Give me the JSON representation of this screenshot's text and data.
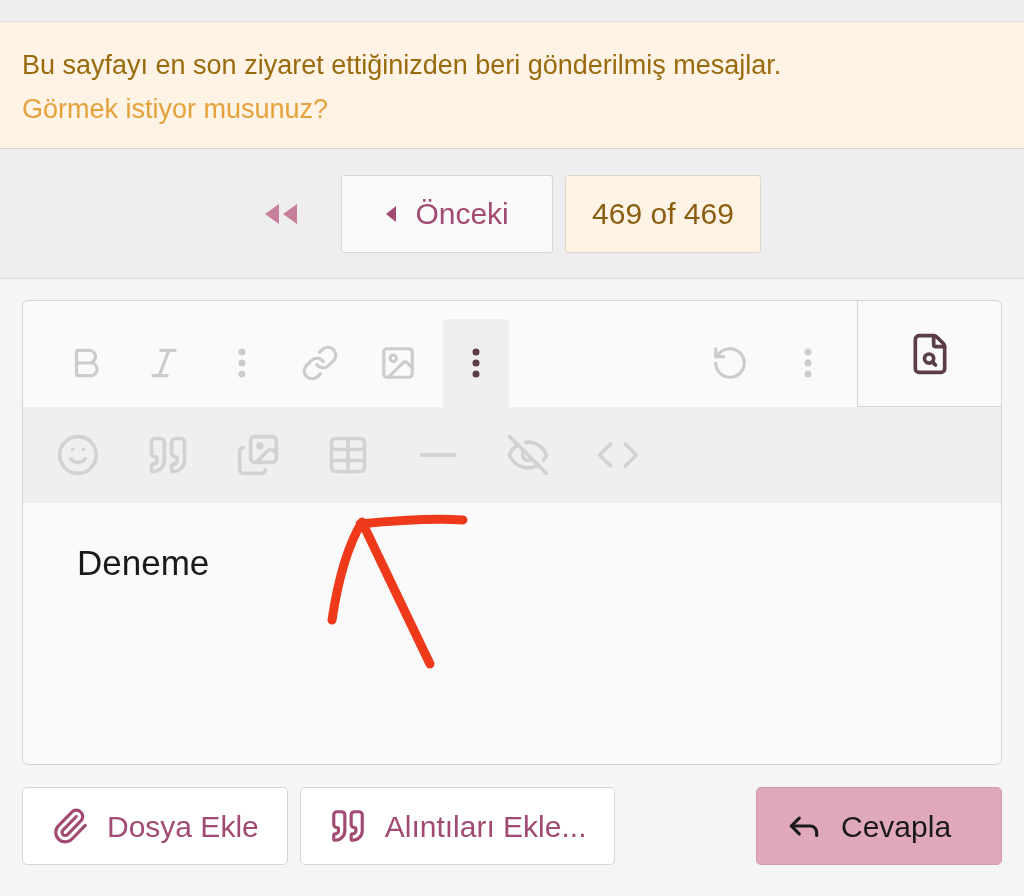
{
  "notice": {
    "message": "Bu sayfayı en son ziyaret ettiğinizden beri gönderilmiş mesajlar.",
    "link": "Görmek istiyor musunuz?"
  },
  "pagination": {
    "previous": "Önceki",
    "page": "469 of 469"
  },
  "editor": {
    "toolbar_row_1": [
      {
        "kind": "bold",
        "expanded": false
      },
      {
        "kind": "italic",
        "expanded": false
      },
      {
        "kind": "more",
        "expanded": false
      },
      {
        "kind": "link",
        "expanded": false
      },
      {
        "kind": "image",
        "expanded": false
      },
      {
        "kind": "more",
        "expanded": true
      },
      {
        "kind": "spacer"
      },
      {
        "kind": "undo",
        "expanded": false
      },
      {
        "kind": "more",
        "expanded": false
      }
    ],
    "toolbar_row_2": [
      {
        "kind": "smilie"
      },
      {
        "kind": "quote"
      },
      {
        "kind": "media"
      },
      {
        "kind": "table"
      },
      {
        "kind": "rule"
      },
      {
        "kind": "spoiler"
      },
      {
        "kind": "code"
      }
    ],
    "value": "Deneme"
  },
  "actions": [
    {
      "kind": "attach",
      "label": "Dosya Ekle"
    },
    {
      "kind": "quotes",
      "label": "Alıntıları Ekle..."
    },
    {
      "kind": "reply",
      "label": "Cevapla"
    }
  ]
}
